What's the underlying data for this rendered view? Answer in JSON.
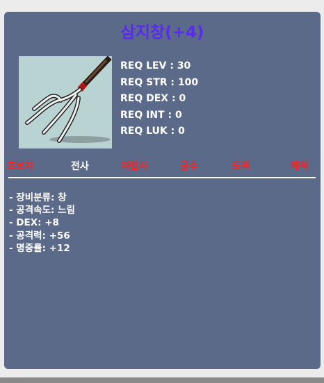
{
  "item": {
    "name": "삼지창(+4)",
    "icon": "trident-icon",
    "name_color": "#5a2bef"
  },
  "requirements": [
    "REQ LEV : 30",
    "REQ STR : 100",
    "REQ DEX : 0",
    "REQ INT : 0",
    "REQ LUK : 0"
  ],
  "jobs": [
    {
      "label": "초보자",
      "allowed": false,
      "color": "#ff2020"
    },
    {
      "label": "전사",
      "allowed": true,
      "color": "#ffffff"
    },
    {
      "label": "마법사",
      "allowed": false,
      "color": "#ff2020"
    },
    {
      "label": "궁수",
      "allowed": false,
      "color": "#ff2020"
    },
    {
      "label": "도적",
      "allowed": false,
      "color": "#ff2020"
    },
    {
      "label": "해적",
      "allowed": false,
      "color": "#ff2020"
    }
  ],
  "stats": [
    "- 장비분류: 창",
    "- 공격속도: 느림",
    "- DEX: +8",
    "- 공격력: +56",
    "- 명중률: +12"
  ]
}
